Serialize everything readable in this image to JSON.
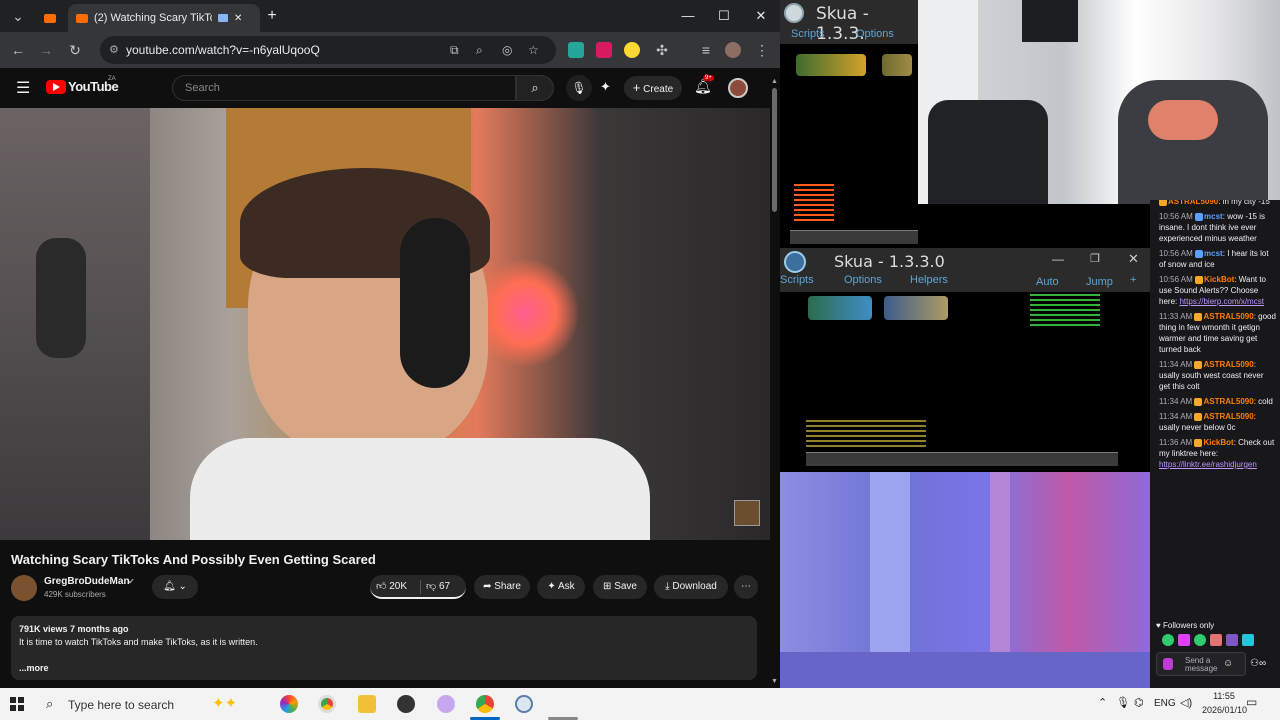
{
  "browser": {
    "tabs": [
      {
        "label": "",
        "icon": "youtube-pinned-icon"
      },
      {
        "label": "(2) Watching Scary TikToks",
        "icon": "youtube-tab-icon"
      }
    ],
    "new_tab": "+",
    "url": "youtube.com/watch?v=-n6yalUqooQ",
    "window_controls": {
      "minimize": "—",
      "maximize": "☐",
      "close": "✕"
    }
  },
  "youtube": {
    "logo": "YouTube",
    "country": "ZA",
    "search_placeholder": "Search",
    "create_label": "Create",
    "notification_count": "9+",
    "video_title": "Watching Scary TikToks And Possibly Even Getting Scared",
    "channel_name": "GregBroDudeMan",
    "subscribers": "429K subscribers",
    "likes": "20K",
    "dislikes": "67",
    "share_label": "Share",
    "ask_label": "Ask",
    "save_label": "Save",
    "download_label": "Download",
    "description": {
      "meta": "791K views  7 months ago",
      "text": "It is time to watch TikToks and make TikToks, as it is written.",
      "more": "...more"
    }
  },
  "skua_top": {
    "title": "Skua - 1.3.3.",
    "menu": [
      "Scripts",
      "Options"
    ]
  },
  "skua_main": {
    "title": "Skua - 1.3.3.0",
    "menu": [
      "Scripts",
      "Options",
      "Helpers"
    ],
    "right_menu": [
      "Auto",
      "Jump",
      "+"
    ]
  },
  "chat": {
    "messages": [
      {
        "time": "",
        "user": "ASTRAL5090",
        "user_color": "orange",
        "text": "in my city -15"
      },
      {
        "time": "10:56 AM",
        "user": "mcst",
        "user_color": "blue",
        "text": "wow -15 is insane. I dont think ive ever experienced minus weather"
      },
      {
        "time": "10:56 AM",
        "user": "mcst",
        "user_color": "blue",
        "text": "I hear its lot of snow and ice"
      },
      {
        "time": "10:56 AM",
        "user": "KickBot",
        "user_color": "orange",
        "text": "Want to use Sound Alerts?? Choose here: ",
        "link": "https://bierp.com/x/mcst"
      },
      {
        "time": "11:33 AM",
        "user": "ASTRAL5090",
        "user_color": "orange",
        "text": "good thing in few wmonth it getign warmer and time saving get turned back"
      },
      {
        "time": "11:34 AM",
        "user": "ASTRAL5090",
        "user_color": "orange",
        "text": "usally south west coast never get this colt"
      },
      {
        "time": "11:34 AM",
        "user": "ASTRAL5090",
        "user_color": "orange",
        "text": "cold"
      },
      {
        "time": "11:34 AM",
        "user": "ASTRAL5090",
        "user_color": "orange",
        "text": "usally never below 0c"
      },
      {
        "time": "11:36 AM",
        "user": "KickBot",
        "user_color": "orange",
        "text": "Check out my linktree here: ",
        "link": "https://linktr.ee/rashidjurgen"
      }
    ],
    "followers_only": "Followers only",
    "send_placeholder": "Send a message"
  },
  "taskbar": {
    "search_placeholder": "Type here to search",
    "tray_lang": "ENG",
    "time": "11:55",
    "date": "2026/01/10"
  },
  "colors": {
    "yt_red": "#ff0000",
    "chat_bg": "#18181b",
    "skua_bg": "#2b2b2b"
  }
}
